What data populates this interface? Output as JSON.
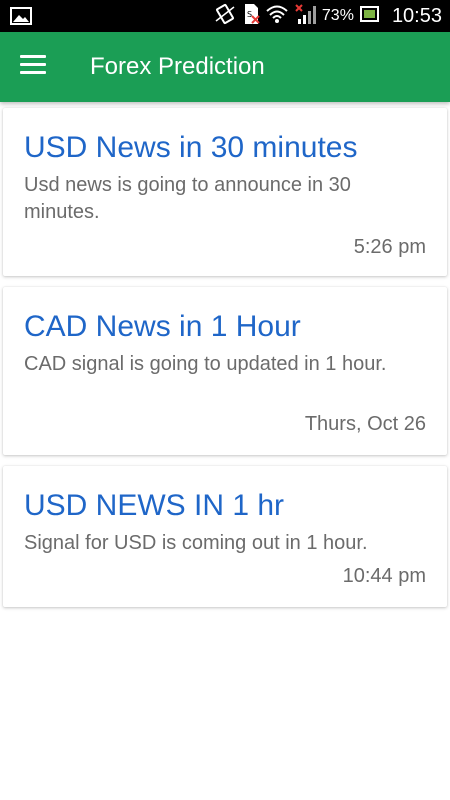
{
  "status_bar": {
    "battery_percent": "73%",
    "time": "10:53",
    "icons": [
      "gallery-icon",
      "vibrate-icon",
      "sim-icon",
      "wifi-icon",
      "signal-icon",
      "battery-icon"
    ]
  },
  "app_bar": {
    "title": "Forex Prediction",
    "menu_icon": "hamburger-menu-icon",
    "color": "#1b9e55"
  },
  "notifications": [
    {
      "title": "USD News in 30 minutes",
      "body": "Usd news is going to announce in 30 minutes.",
      "time": "5:26 pm"
    },
    {
      "title": "CAD News in 1 Hour",
      "body": "CAD signal is going to updated in 1 hour.",
      "time": "Thurs, Oct 26"
    },
    {
      "title": "USD NEWS IN 1 hr",
      "body": "Signal for USD is coming out in 1 hour.",
      "time": "10:44 pm"
    }
  ],
  "colors": {
    "title_blue": "#1f66c8",
    "body_gray": "#6b6b6b"
  }
}
